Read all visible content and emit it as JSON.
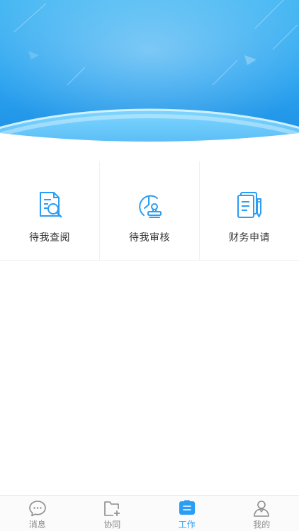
{
  "banner": {
    "gradient_top": "#4fc0f5",
    "gradient_bottom": "#1d8fe6"
  },
  "grid": {
    "items": [
      {
        "label": "待我查阅",
        "icon": "document-search-icon"
      },
      {
        "label": "待我审核",
        "icon": "clock-stamp-icon"
      },
      {
        "label": "财务申请",
        "icon": "document-pen-icon"
      }
    ]
  },
  "tabbar": {
    "active_color": "#2a9df4",
    "inactive_color": "#8c8c8c",
    "items": [
      {
        "label": "消息",
        "icon": "chat-bubble-icon",
        "active": false
      },
      {
        "label": "协同",
        "icon": "folder-add-icon",
        "active": false
      },
      {
        "label": "工作",
        "icon": "briefcase-icon",
        "active": true
      },
      {
        "label": "我的",
        "icon": "user-icon",
        "active": false
      }
    ]
  }
}
